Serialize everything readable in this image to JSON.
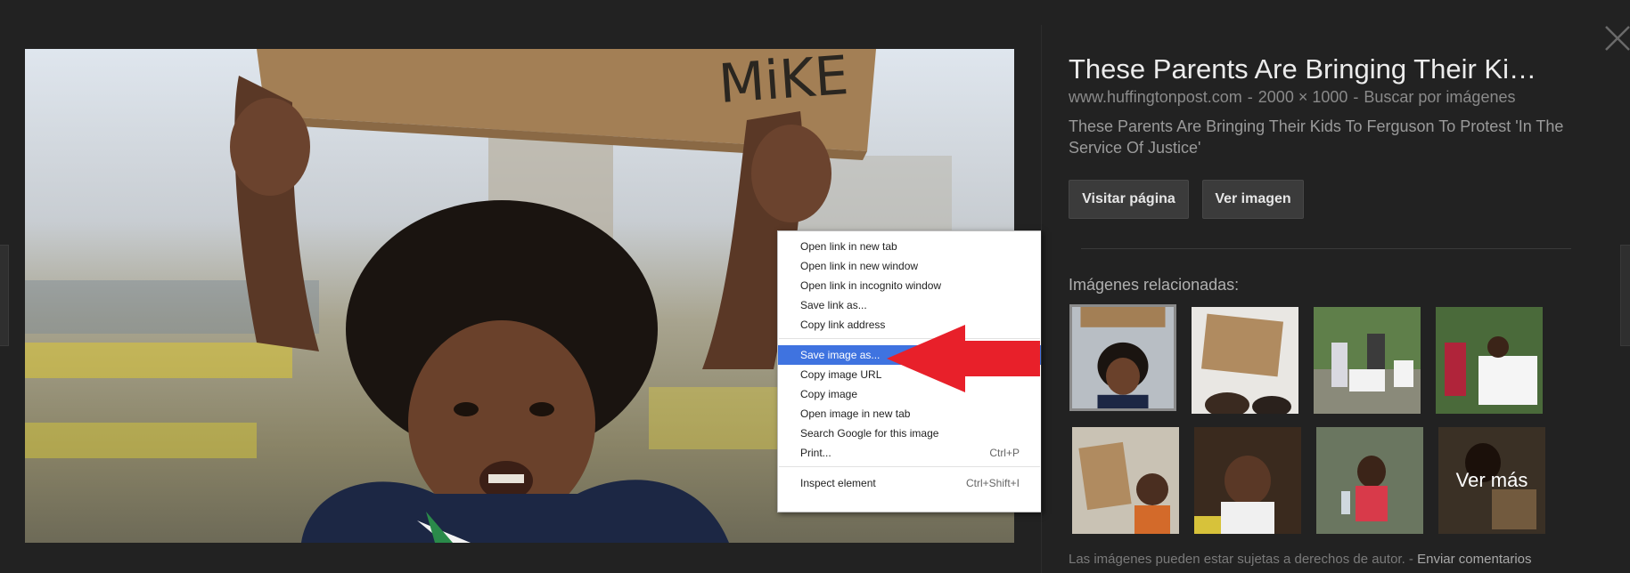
{
  "detail": {
    "title": "These Parents Are Bringing Their Ki…",
    "source": "www.huffingtonpost.com",
    "dimensions": "2000 × 1000",
    "search_by_image": "Buscar por imágenes",
    "description": "These Parents Are Bringing Their Kids To Ferguson To Protest 'In The Service Of Justice'",
    "visit_button": "Visitar página",
    "view_button": "Ver imagen",
    "related_label": "Imágenes relacionadas:",
    "see_more": "Ver más",
    "footer_text": "Las imágenes pueden estar sujetas a derechos de autor.",
    "footer_link": "Enviar comentarios"
  },
  "image": {
    "sign_text": "MiKE"
  },
  "context_menu": {
    "items": [
      {
        "label": "Open link in new tab",
        "shortcut": ""
      },
      {
        "label": "Open link in new window",
        "shortcut": ""
      },
      {
        "label": "Open link in incognito window",
        "shortcut": ""
      },
      {
        "label": "Save link as...",
        "shortcut": ""
      },
      {
        "label": "Copy link address",
        "shortcut": ""
      },
      {
        "label": "Save image as...",
        "shortcut": ""
      },
      {
        "label": "Copy image URL",
        "shortcut": ""
      },
      {
        "label": "Copy image",
        "shortcut": ""
      },
      {
        "label": "Open image in new tab",
        "shortcut": ""
      },
      {
        "label": "Search Google for this image",
        "shortcut": ""
      },
      {
        "label": "Print...",
        "shortcut": "Ctrl+P"
      },
      {
        "label": "Inspect element",
        "shortcut": "Ctrl+Shift+I"
      }
    ]
  },
  "colors": {
    "background": "#222222",
    "menu_highlight": "#3f73e0",
    "arrow": "#e8202a"
  }
}
